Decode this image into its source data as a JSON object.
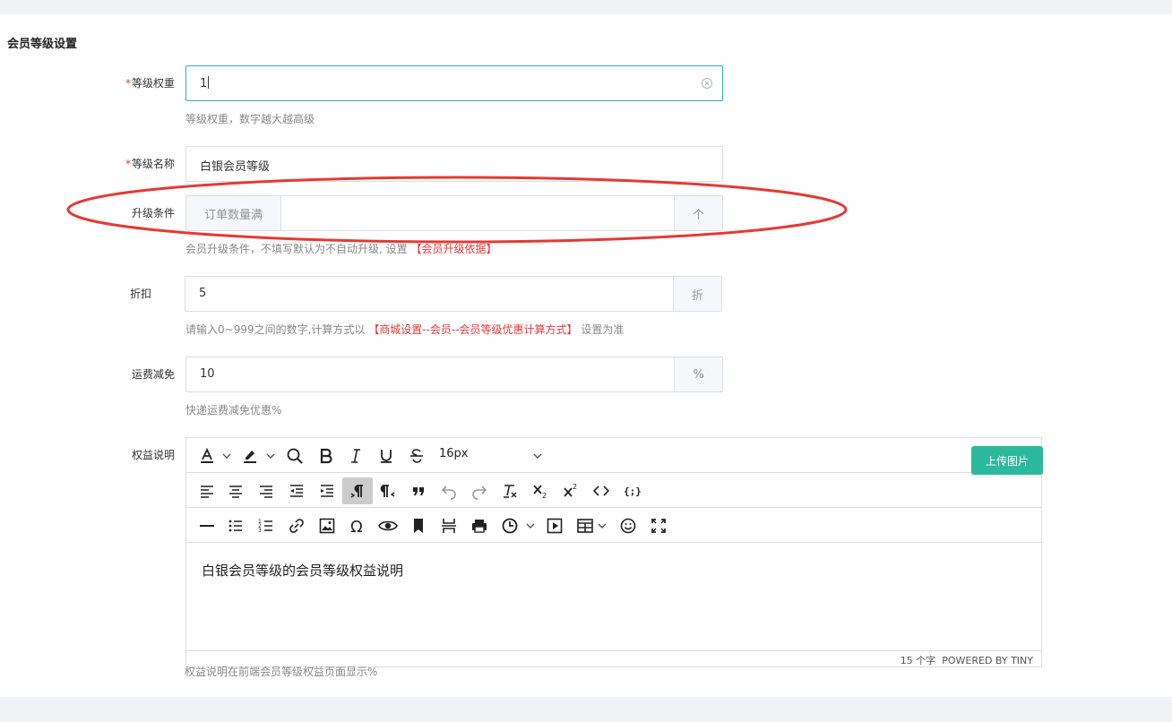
{
  "section_title": "会员等级设置",
  "fields": {
    "weight": {
      "label": "等级权重",
      "value": "1",
      "hint": "等级权重，数字越大越高级"
    },
    "name": {
      "label": "等级名称",
      "value": "白银会员等级"
    },
    "upgrade": {
      "label": "升级条件",
      "prefix": "订单数量满",
      "value": "",
      "suffix": "个",
      "hint_text": "会员升级条件，不填写默认为不自动升级, 设置 ",
      "hint_link": "【会员升级依据】"
    },
    "discount": {
      "label": "折扣",
      "value": "5",
      "suffix": "折",
      "hint_text": "请输入0~999之间的数字,计算方式以 ",
      "hint_link": "【商城设置--会员--会员等级优惠计算方式】",
      "hint_after": " 设置为准"
    },
    "shipping": {
      "label": "运费减免",
      "value": "10",
      "suffix": "%",
      "hint": "快递运费减免优惠%"
    },
    "benefits": {
      "label": "权益说明",
      "hint": "权益说明在前端会员等级权益页面显示%"
    }
  },
  "editor": {
    "font_size": "16px",
    "upload_label": "上传图片",
    "content": "白银会员等级的会员等级权益说明",
    "word_count": "15 个字",
    "powered_by": "POWERED BY TINY",
    "toolbar_row1": [
      "text-color-icon",
      "chevron-down-icon",
      "highlight-color-icon",
      "chevron-down-icon",
      "search-icon",
      "bold-icon",
      "italic-icon",
      "underline-icon",
      "strikethrough-icon",
      "font-size-select"
    ],
    "toolbar_row2": [
      "align-left-icon",
      "align-center-icon",
      "align-right-icon",
      "outdent-icon",
      "indent-icon",
      "ltr-icon",
      "rtl-icon",
      "blockquote-icon",
      "undo-icon",
      "redo-icon",
      "remove-format-icon",
      "subscript-icon",
      "superscript-icon",
      "code-icon",
      "code-sample-icon"
    ],
    "toolbar_row3": [
      "horizontal-line-icon",
      "bullet-list-icon",
      "numbered-list-icon",
      "link-icon",
      "image-icon",
      "special-char-icon",
      "preview-icon",
      "bookmark-icon",
      "page-break-icon",
      "print-icon",
      "time-icon",
      "media-icon",
      "table-icon",
      "emoji-icon",
      "fullscreen-icon"
    ]
  },
  "colors": {
    "accent": "#2cb99c",
    "required": "#e4393c",
    "annotation": "#e53935"
  }
}
